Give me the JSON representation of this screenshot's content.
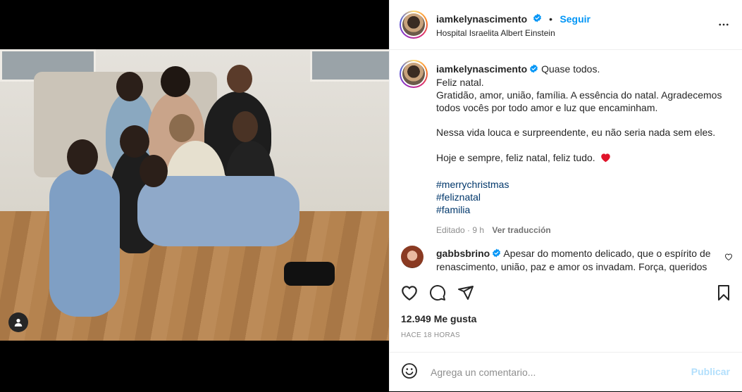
{
  "post": {
    "author": "iamkelynascimento",
    "follow_label": "Seguir",
    "location": "Hospital Israelita Albert Einstein",
    "caption_first": "Quase todos.",
    "caption_lines": [
      "Feliz natal.",
      "Gratidão, amor, união, família. A essência do natal. Agradecemos",
      "todos vocês por todo amor e luz que encaminham.",
      "Nessa vida louca e surpreendente, eu não seria nada sem eles.",
      "Hoje e sempre, feliz natal, feliz tudo."
    ],
    "hashtags": [
      "#merrychristmas",
      "#feliznatal",
      "#familia"
    ],
    "edited_label": "Editado · 9 h",
    "translate_label": "Ver traducción",
    "likes": "12.949 Me gusta",
    "time_ago": "HACE 18 HORAS"
  },
  "comment": {
    "user": "gabbsbrino",
    "text": "Apesar do momento delicado, que o espírito de renascimento, união, paz e amor os invadam. Força, queridos"
  },
  "add_comment": {
    "placeholder": "Agrega un comentario...",
    "publish_label": "Publicar"
  },
  "colors": {
    "accent": "#0095f6",
    "verified": "#0095f6",
    "heart": "#ed4956",
    "hashtag": "#00376b",
    "muted": "#8e8e8e"
  },
  "icons": {
    "verified": "verified-badge-icon",
    "more": "more-horizontal-icon",
    "like": "heart-icon",
    "comment": "comment-bubble-icon",
    "share": "paper-plane-icon",
    "save": "bookmark-icon",
    "emoji": "emoji-smile-icon",
    "tagged_user": "user-tag-icon"
  }
}
